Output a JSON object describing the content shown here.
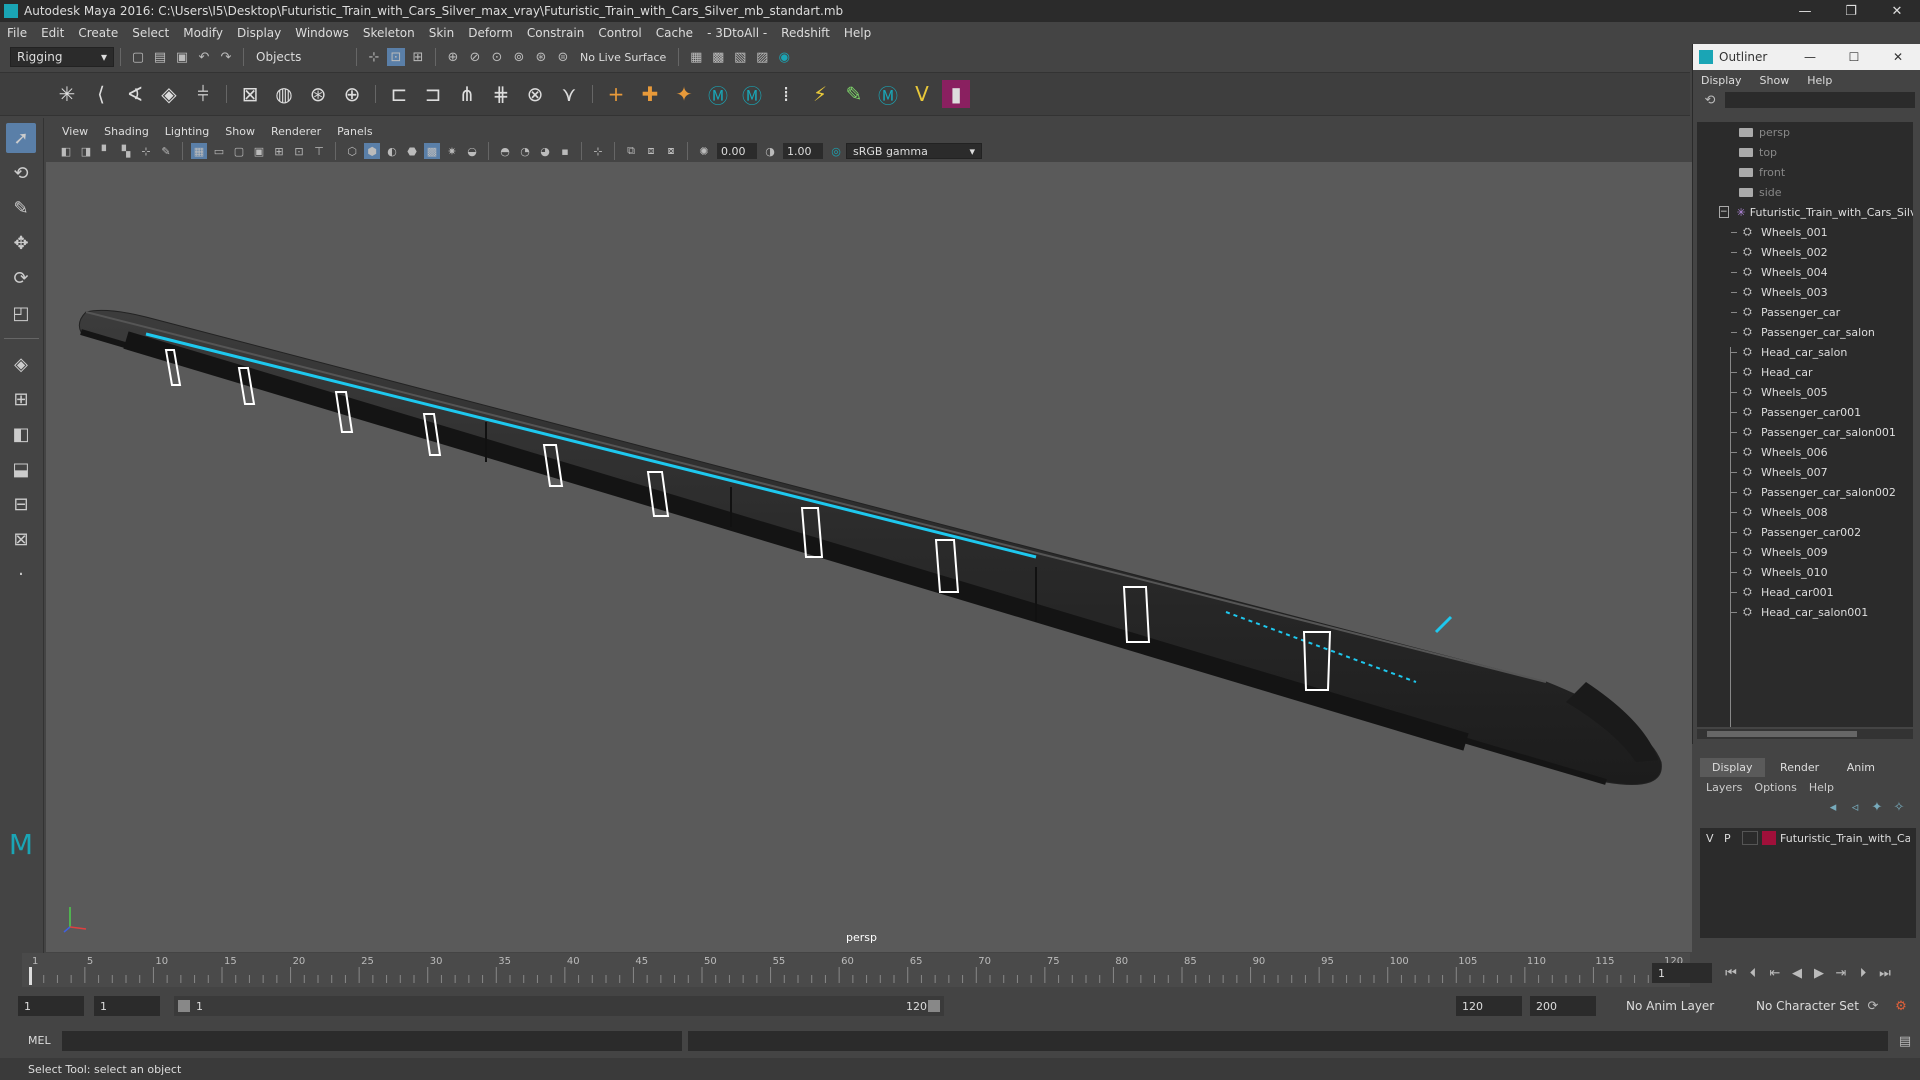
{
  "titlebar": {
    "title": "Autodesk Maya 2016: C:\\Users\\I5\\Desktop\\Futuristic_Train_with_Cars_Silver_max_vray\\Futuristic_Train_with_Cars_Silver_mb_standart.mb",
    "minimize": "—",
    "restore": "❐",
    "close": "✕"
  },
  "menubar": [
    "File",
    "Edit",
    "Create",
    "Select",
    "Modify",
    "Display",
    "Windows",
    "Skeleton",
    "Skin",
    "Deform",
    "Constrain",
    "Control",
    "Cache",
    "- 3DtoAll -",
    "Redshift",
    "Help"
  ],
  "statusline": {
    "mode": "Rigging",
    "selection_mode": "Objects",
    "live_surface": "No Live Surface"
  },
  "viewport": {
    "menu": [
      "View",
      "Shading",
      "Lighting",
      "Show",
      "Renderer",
      "Panels"
    ],
    "exposure": "0.00",
    "gamma": "1.00",
    "color_space": "sRGB gamma",
    "camera": "persp"
  },
  "timeline": {
    "ticks": [
      "1",
      "5",
      "10",
      "15",
      "20",
      "25",
      "30",
      "35",
      "40",
      "45",
      "50",
      "55",
      "60",
      "65",
      "70",
      "75",
      "80",
      "85",
      "90",
      "95",
      "100",
      "105",
      "110",
      "115",
      "120"
    ],
    "current_frame": "1",
    "range_start": "1",
    "range_start2": "1",
    "slider_start": "1",
    "slider_end": "120",
    "end": "120",
    "total_end": "200",
    "anim_layer": "No Anim Layer",
    "char_set": "No Character Set"
  },
  "cmdline": {
    "label": "MEL",
    "help": "Select Tool: select an object"
  },
  "outliner": {
    "title": "Outliner",
    "menu": [
      "Display",
      "Show",
      "Help"
    ],
    "cameras": [
      "persp",
      "top",
      "front",
      "side"
    ],
    "root": "Futuristic_Train_with_Cars_Silver",
    "children": [
      "Wheels_001",
      "Wheels_002",
      "Wheels_004",
      "Wheels_003",
      "Passenger_car",
      "Passenger_car_salon",
      "Head_car_salon",
      "Head_car",
      "Wheels_005",
      "Passenger_car001",
      "Passenger_car_salon001",
      "Wheels_006",
      "Wheels_007",
      "Passenger_car_salon002",
      "Wheels_008",
      "Passenger_car002",
      "Wheels_009",
      "Wheels_010",
      "Head_car001",
      "Head_car_salon001"
    ]
  },
  "layers": {
    "tabs": [
      "Display",
      "Render",
      "Anim"
    ],
    "menu": [
      "Layers",
      "Options",
      "Help"
    ],
    "layer": {
      "v": "V",
      "p": "P",
      "name": "Futuristic_Train_with_Cars_Silver",
      "color": "#a0103a"
    }
  }
}
